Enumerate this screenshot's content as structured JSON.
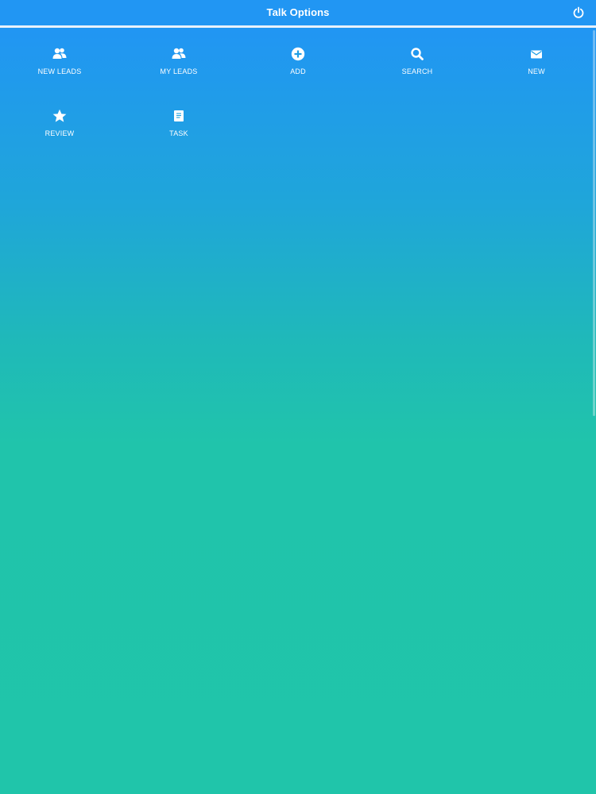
{
  "header": {
    "title": "Talk Options",
    "power_icon": "power-icon"
  },
  "menu": {
    "items": [
      {
        "label": "NEW LEADS",
        "icon": "users-icon"
      },
      {
        "label": "MY LEADS",
        "icon": "users-icon"
      },
      {
        "label": "ADD",
        "icon": "plus-circle-icon"
      },
      {
        "label": "SEARCH",
        "icon": "search-icon"
      },
      {
        "label": "NEW",
        "icon": "envelope-icon"
      },
      {
        "label": "REVIEW",
        "icon": "star-icon"
      },
      {
        "label": "TASK",
        "icon": "book-icon"
      }
    ]
  },
  "colors": {
    "header": "#2196f3",
    "gradient_top": "#2196f3",
    "gradient_bottom": "#20c5aa",
    "text": "#ffffff"
  }
}
